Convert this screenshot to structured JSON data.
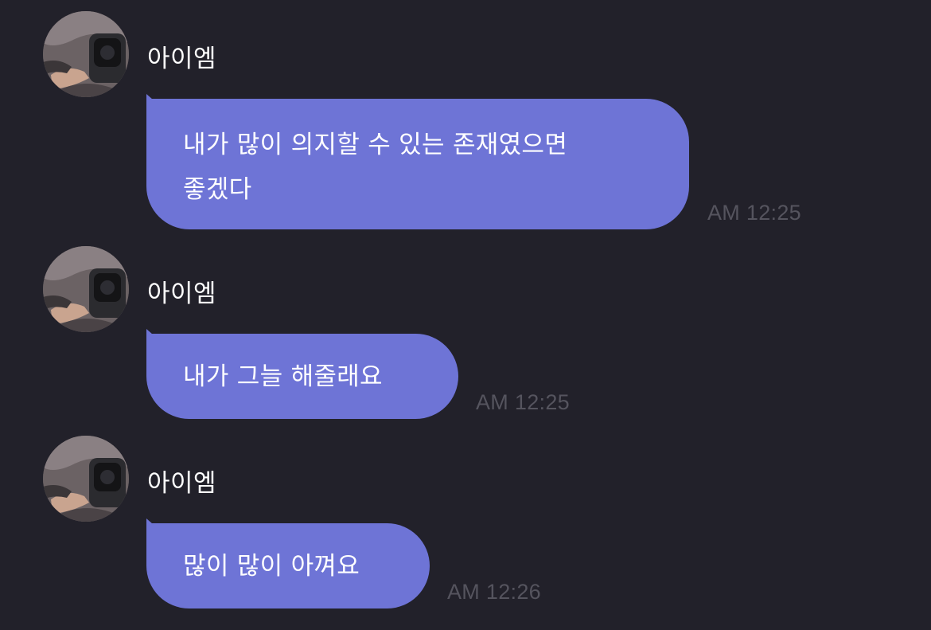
{
  "messages": [
    {
      "sender": "아이엠",
      "avatar_icon": "profile-photo-avatar",
      "text": "내가 많이 의지할 수 있는 존재였으면\n좋겠다",
      "time": "AM 12:25"
    },
    {
      "sender": "아이엠",
      "avatar_icon": "profile-photo-avatar",
      "text": "내가 그늘 해줄래요",
      "time": "AM 12:25"
    },
    {
      "sender": "아이엠",
      "avatar_icon": "profile-photo-avatar",
      "text": "많이 많이 아껴요",
      "time": "AM 12:26"
    }
  ],
  "colors": {
    "background": "#22212a",
    "bubble": "#6e74d6",
    "timestamp": "#55545e",
    "text": "#ffffff"
  }
}
